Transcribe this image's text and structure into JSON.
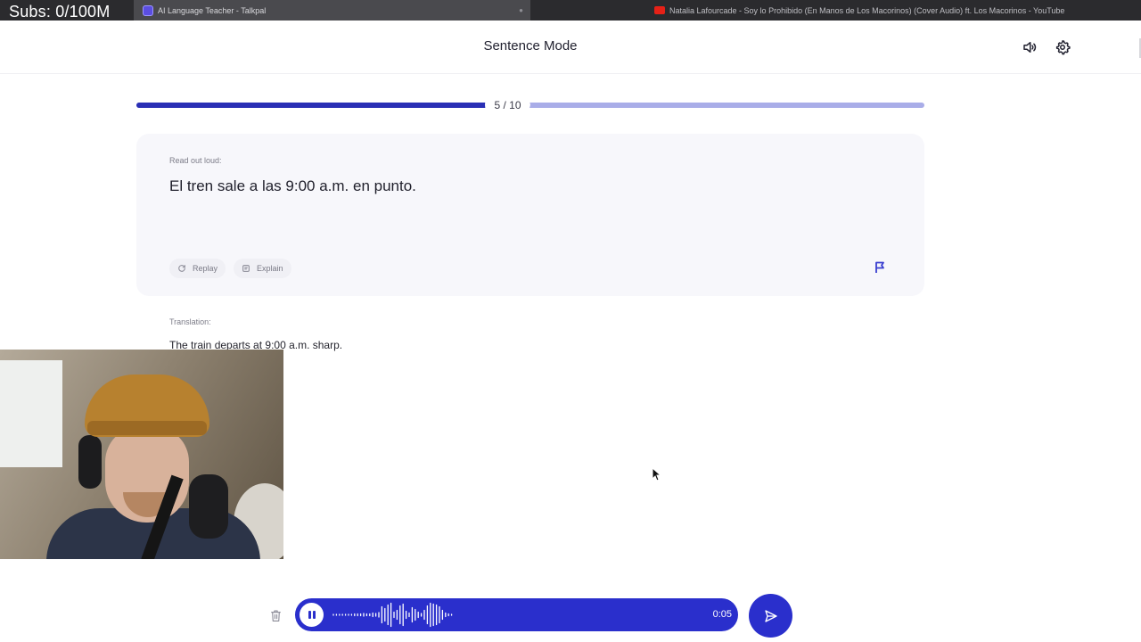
{
  "overlay": {
    "subs_counter": "Subs: 0/100M"
  },
  "browser": {
    "tabs": [
      {
        "title": "AI Language Teacher - Talkpal",
        "icon": "talkpal-favicon"
      },
      {
        "title": "Natalia Lafourcade - Soy lo Prohibido (En Manos de Los Macorinos) (Cover Audio) ft. Los Macorinos - YouTube",
        "icon": "youtube-favicon"
      }
    ]
  },
  "header": {
    "title": "Sentence Mode",
    "icons": {
      "sound": "speaker-icon",
      "settings": "gear-icon"
    }
  },
  "progress": {
    "current": 5,
    "total": 10,
    "label": "5 / 10",
    "fraction": 0.5
  },
  "card": {
    "caption": "Read out loud:",
    "sentence": "El tren sale a las 9:00 a.m. en punto.",
    "replay_label": "Replay",
    "explain_label": "Explain",
    "flag_icon": "flag-icon"
  },
  "translation": {
    "caption": "Translation:",
    "text": "The train departs at 9:00 a.m. sharp."
  },
  "recorder": {
    "time": "0:05",
    "icons": {
      "delete": "trash-icon",
      "pause": "pause-icon",
      "send": "send-icon"
    }
  },
  "colors": {
    "accent": "#2a2fcc",
    "progress_fill": "#2a2fb5",
    "progress_track": "#a9ade8",
    "card_bg": "#f7f7fb"
  }
}
